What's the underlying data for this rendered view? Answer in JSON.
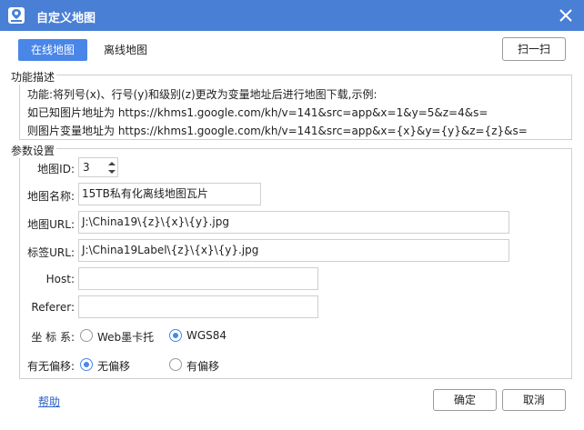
{
  "window": {
    "title": "自定义地图",
    "accent_color": "#4a7fd6",
    "icons": [
      "map-app-icon",
      "close-icon"
    ]
  },
  "tabs": [
    {
      "label": "在线地图",
      "active": true
    },
    {
      "label": "离线地图",
      "active": false
    }
  ],
  "scan_button": "扫一扫",
  "func_desc": {
    "title": "功能描述",
    "lines": [
      "功能:将列号(x)、行号(y)和级别(z)更改为变量地址后进行地图下载,示例:",
      "如已知图片地址为 https://khms1.google.com/kh/v=141&src=app&x=1&y=5&z=4&s=",
      "则图片变量地址为 https://khms1.google.com/kh/v=141&src=app&x={x}&y={y}&z={z}&s="
    ]
  },
  "params": {
    "title": "参数设置",
    "map_id": {
      "label": "地图ID:",
      "value": "3"
    },
    "map_name": {
      "label": "地图名称:",
      "value": "15TB私有化离线地图瓦片"
    },
    "map_url": {
      "label": "地图URL:",
      "value": "J:\\China19\\{z}\\{x}\\{y}.jpg"
    },
    "label_url": {
      "label": "标签URL:",
      "value": "J:\\China19Label\\{z}\\{x}\\{y}.jpg"
    },
    "host": {
      "label": "Host:",
      "value": ""
    },
    "referer": {
      "label": "Referer:",
      "value": ""
    },
    "coord_system": {
      "label": "坐 标 系:",
      "options": [
        "Web墨卡托",
        "WGS84"
      ],
      "selected": "WGS84"
    },
    "offset": {
      "label": "有无偏移:",
      "options": [
        "无偏移",
        "有偏移"
      ],
      "selected": "无偏移"
    }
  },
  "footer": {
    "help": "帮助",
    "ok": "确定",
    "cancel": "取消"
  }
}
